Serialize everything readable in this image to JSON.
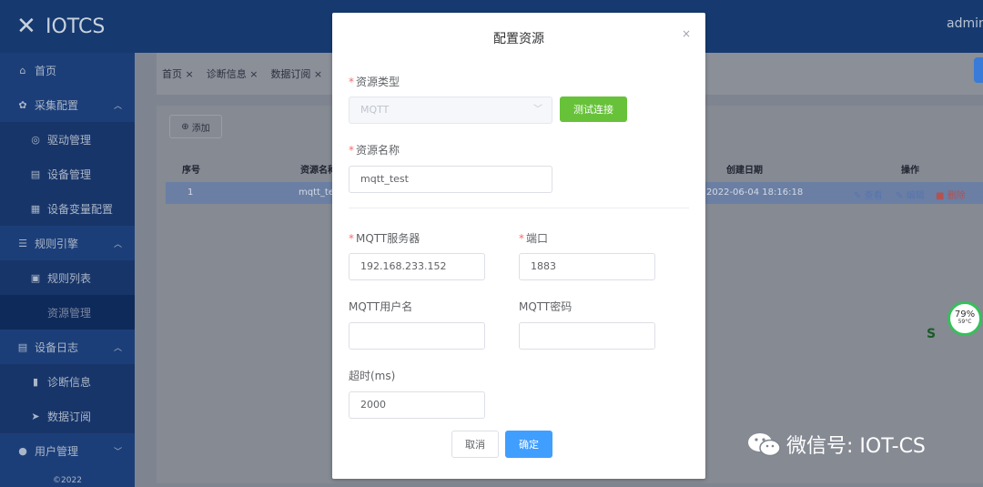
{
  "app": {
    "logo_text": "IOTCS",
    "user": "admin"
  },
  "sidebar": {
    "items": [
      {
        "label": "首页",
        "icon": "home-icon"
      },
      {
        "label": "采集配置",
        "icon": "gear-icon",
        "expanded": true
      },
      {
        "label": "驱动管理",
        "icon": "driver-icon"
      },
      {
        "label": "设备管理",
        "icon": "device-icon"
      },
      {
        "label": "设备变量配置",
        "icon": "grid-icon"
      },
      {
        "label": "规则引擎",
        "icon": "rules-icon",
        "expanded": true
      },
      {
        "label": "规则列表",
        "icon": "clipboard-icon"
      },
      {
        "label": "资源管理",
        "icon": "resource-icon",
        "active": true
      },
      {
        "label": "设备日志",
        "icon": "log-icon",
        "expanded": true
      },
      {
        "label": "诊断信息",
        "icon": "bar-chart-icon"
      },
      {
        "label": "数据订阅",
        "icon": "send-icon"
      },
      {
        "label": "用户管理",
        "icon": "user-icon",
        "expanded": false
      }
    ],
    "copyright": "©2022"
  },
  "tabs": [
    "首页 ×",
    "诊断信息 ×",
    "数据订阅 ×"
  ],
  "table": {
    "add_label": "添加",
    "headers": {
      "index": "序号",
      "name": "资源名称",
      "created": "创建日期",
      "actions": "操作"
    },
    "rows": [
      {
        "index": "1",
        "name": "mqtt_tes",
        "created": "2022-06-04 18:16:18",
        "view": "查看",
        "edit": "编辑",
        "delete": "删除"
      }
    ]
  },
  "modal": {
    "title": "配置资源",
    "close": "×",
    "resource_type_label": "资源类型",
    "resource_type_value": "MQTT",
    "test_button": "测试连接",
    "resource_name_label": "资源名称",
    "resource_name_value": "mqtt_test",
    "server_label": "MQTT服务器",
    "server_value": "192.168.233.152",
    "port_label": "端口",
    "port_value": "1883",
    "username_label": "MQTT用户名",
    "username_value": "",
    "password_label": "MQTT密码",
    "password_value": "",
    "timeout_label": "超时(ms)",
    "timeout_value": "2000",
    "cancel": "取消",
    "confirm": "确定"
  },
  "overlays": {
    "gauge_value": "79%",
    "gauge_temp": "59°C",
    "watermark": "微信号: IOT-CS"
  },
  "colors": {
    "primary": "#409eff",
    "success": "#67c23a",
    "sidebar": "#1c3e78",
    "required": "#f56c6c"
  }
}
